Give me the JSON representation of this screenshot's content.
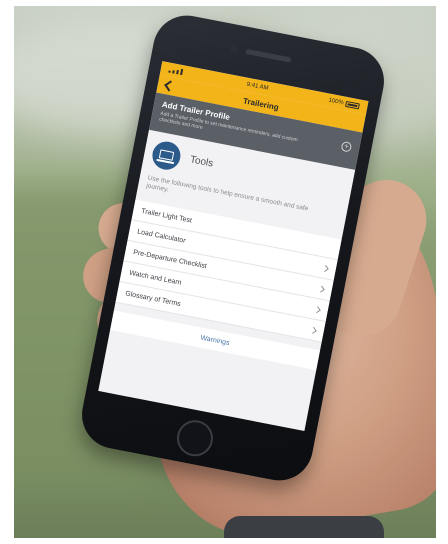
{
  "status_bar": {
    "time": "9:41 AM",
    "battery": "100%"
  },
  "nav": {
    "title": "Trailering",
    "back_icon": "chevron-left-icon"
  },
  "banner": {
    "title": "Add Trailer Profile",
    "subtitle": "Add a Trailer Profile to set maintenance reminders, add custom checklists and more",
    "add_icon": "plus-circle-icon"
  },
  "tools": {
    "title": "Tools",
    "icon": "laptop-icon",
    "description": "Use the following tools to help ensure a smooth and safe journey."
  },
  "menu": {
    "items": [
      {
        "label": "Trailer Light Test"
      },
      {
        "label": "Load Calculator"
      },
      {
        "label": "Pre-Departure Checklist"
      },
      {
        "label": "Watch and Learn"
      },
      {
        "label": "Glossary of Terms"
      }
    ]
  },
  "warnings": {
    "label": "Warnings"
  },
  "colors": {
    "accent": "#f2b418",
    "banner": "#5b5f66",
    "tools_icon_bg": "#2c5a8a",
    "link": "#4a78a8"
  }
}
